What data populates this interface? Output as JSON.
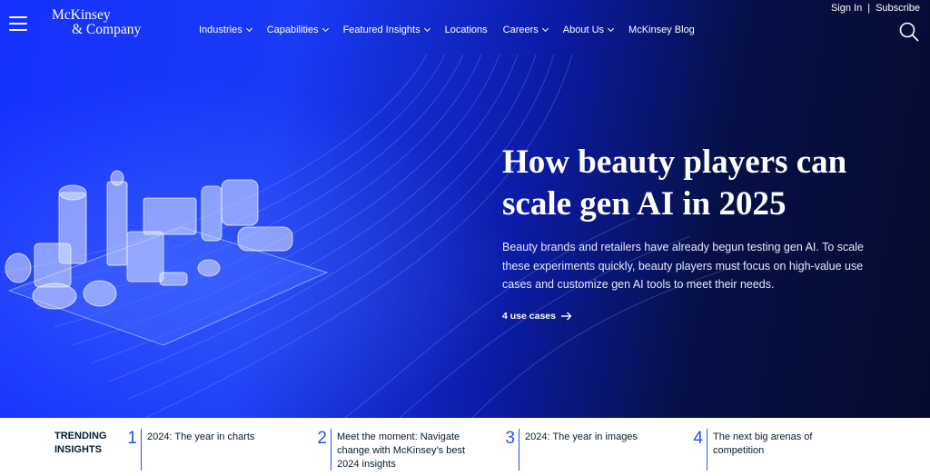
{
  "brand": {
    "line1": "McKinsey",
    "line2": "& Company"
  },
  "nav": [
    {
      "label": "Industries",
      "dropdown": true
    },
    {
      "label": "Capabilities",
      "dropdown": true
    },
    {
      "label": "Featured Insights",
      "dropdown": true
    },
    {
      "label": "Locations",
      "dropdown": false
    },
    {
      "label": "Careers",
      "dropdown": true
    },
    {
      "label": "About Us",
      "dropdown": true
    },
    {
      "label": "McKinsey Blog",
      "dropdown": false
    }
  ],
  "account": {
    "sign_in": "Sign In",
    "separator": "|",
    "subscribe": "Subscribe"
  },
  "icons": {
    "menu": "hamburger-menu-icon",
    "search": "search-icon",
    "arrow": "arrow-right-icon"
  },
  "hero": {
    "headline": "How beauty players can scale gen AI in 2025",
    "summary": "Beauty brands and retailers have already begun testing gen AI. To scale these experiments quickly, beauty players must focus on high-value use cases and customize gen AI tools to meet their needs.",
    "cta": "4 use cases"
  },
  "trending": {
    "label": "TRENDING INSIGHTS",
    "items": [
      {
        "num": "1",
        "text": "2024: The year in charts"
      },
      {
        "num": "2",
        "text": "Meet the moment: Navigate change with McKinsey’s best 2024 insights"
      },
      {
        "num": "3",
        "text": "2024: The year in images"
      },
      {
        "num": "4",
        "text": "The next big arenas of competition"
      }
    ]
  },
  "colors": {
    "accent": "#2251ff",
    "hero_blue": "#1631ff",
    "dark_navy": "#051c2c"
  }
}
